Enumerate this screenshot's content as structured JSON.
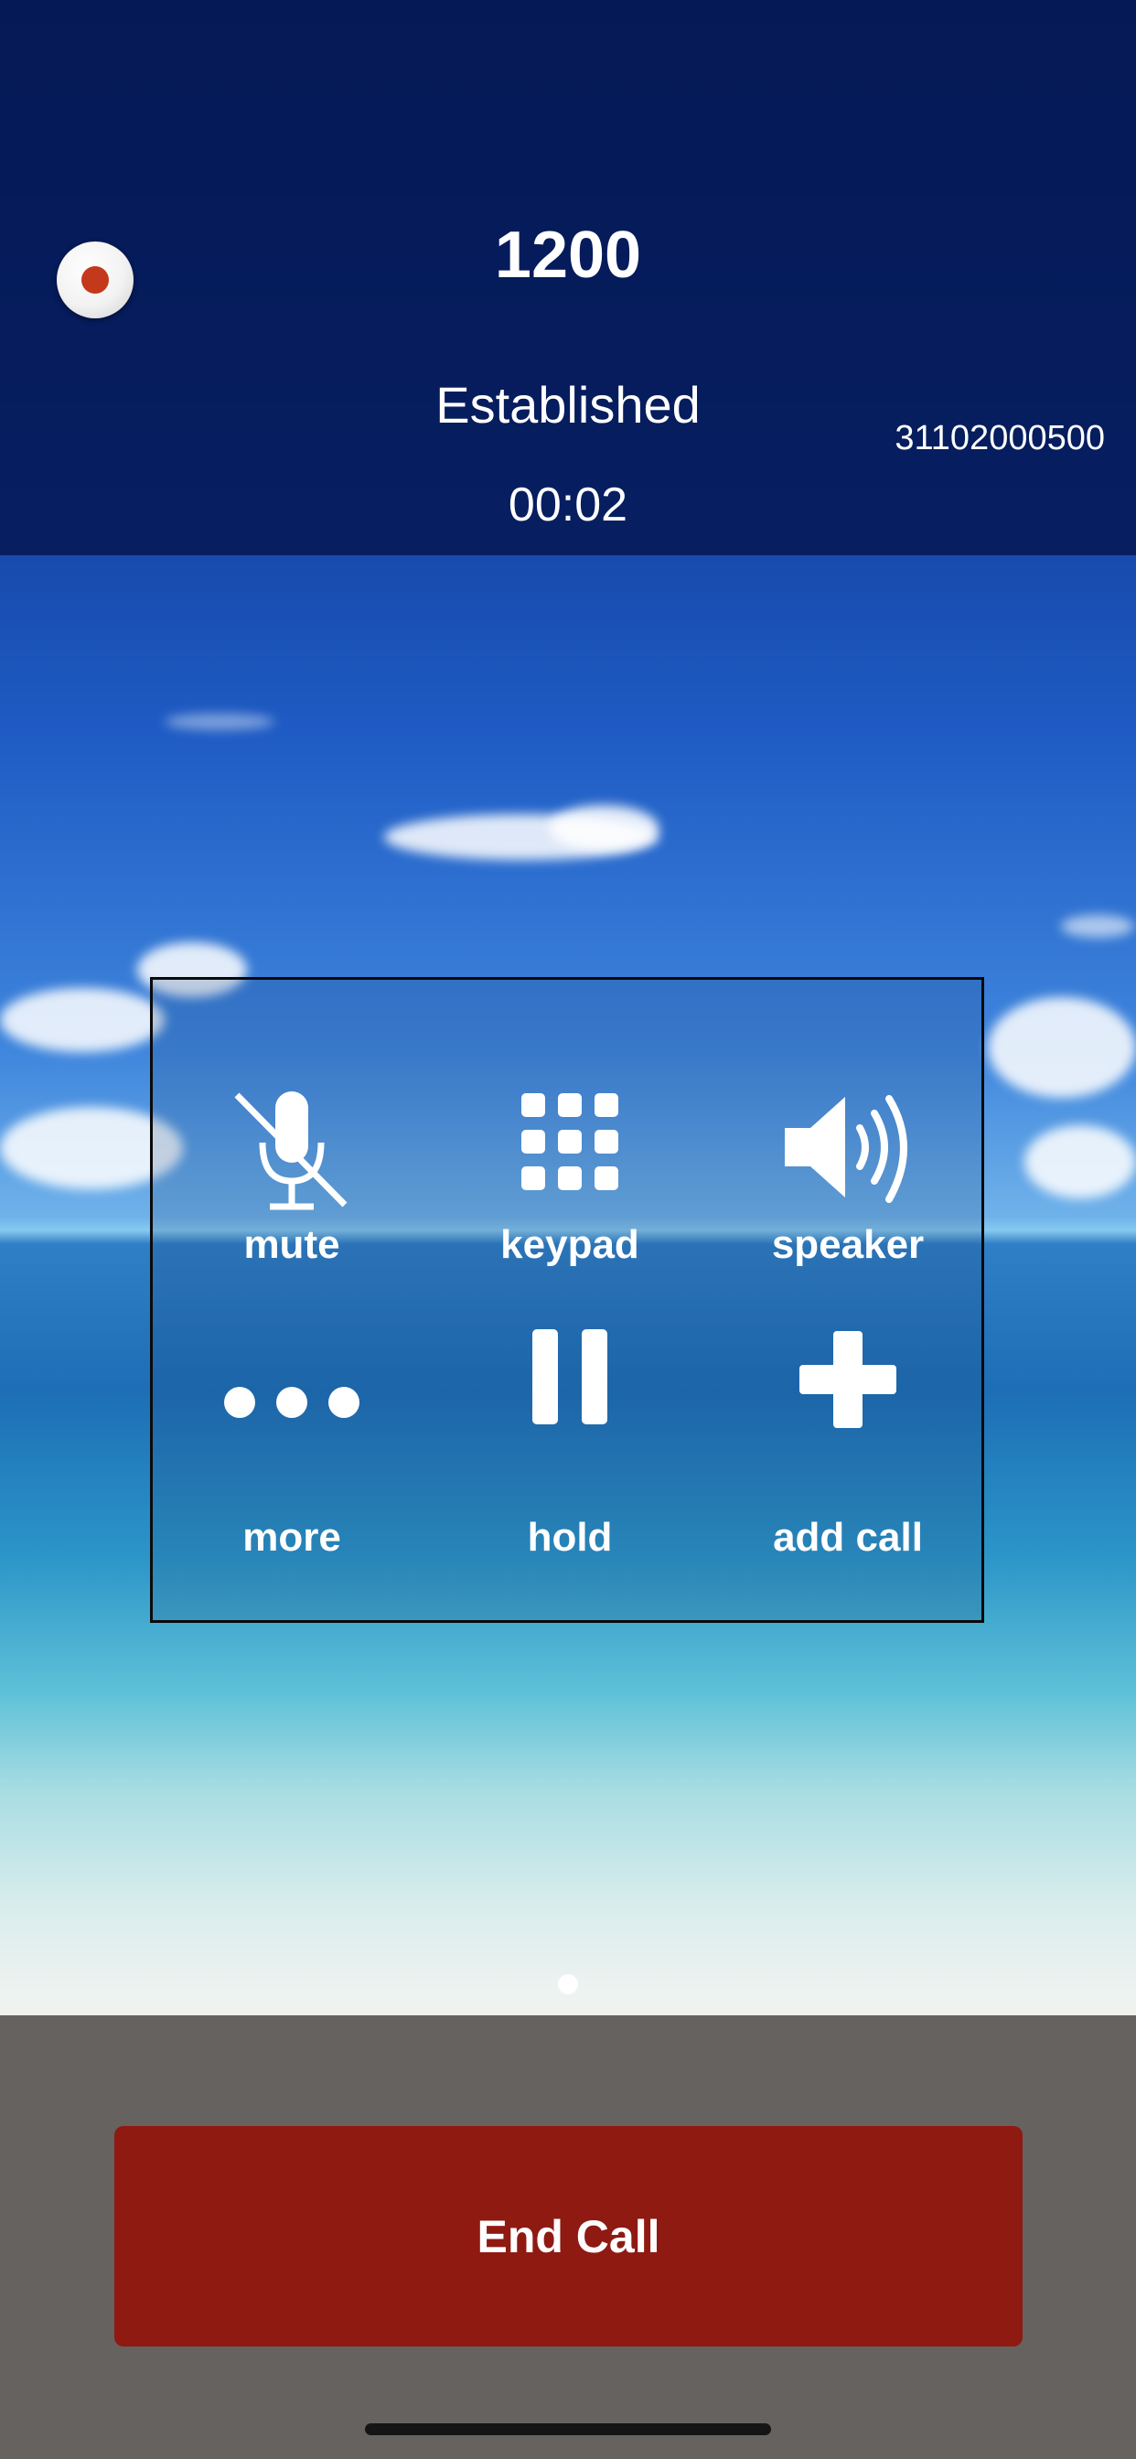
{
  "call": {
    "number": "1200",
    "status": "Established",
    "timer": "00:02",
    "account": "31102000500"
  },
  "controls": [
    {
      "label": "mute",
      "icon": "mic-off-icon"
    },
    {
      "label": "keypad",
      "icon": "keypad-icon"
    },
    {
      "label": "speaker",
      "icon": "speaker-icon"
    },
    {
      "label": "more",
      "icon": "more-icon"
    },
    {
      "label": "hold",
      "icon": "pause-icon"
    },
    {
      "label": "add call",
      "icon": "plus-icon"
    }
  ],
  "end_call_label": "End Call",
  "colors": {
    "end_call": "#8e1a12",
    "record_dot": "#c4391b",
    "header_bg": "#041650"
  }
}
